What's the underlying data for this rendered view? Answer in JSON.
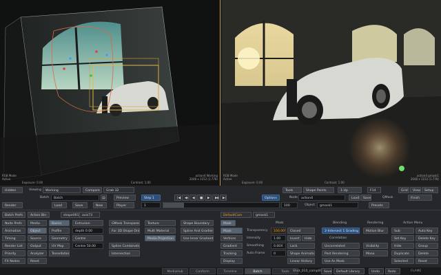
{
  "viewer_left": {
    "mode_line1": "RGB Mode",
    "mode_line2": "Active",
    "exposure": "Exposure: 0.00",
    "contrast": "Contrast: 1.00",
    "name": "action4 Working",
    "res": "2048 x 1152 (1.778)"
  },
  "viewer_right": {
    "mode_line1": "RGB Mode",
    "mode_line2": "Active",
    "exposure": "Exposure: 0.00",
    "contrast": "Contrast: 1.00",
    "name": "action4 gmask1",
    "res": "2048 x 1152 (1.778)"
  },
  "row1": {
    "hidden": "Hidden",
    "viewing_label": "Viewing",
    "viewing_value": "Working",
    "compare": "Compare",
    "grab": "Grab 32",
    "tools": "Tools",
    "shape_points": "Shape Points",
    "view_mode": "1-Up",
    "zoom": "F14",
    "grid": "Grid",
    "view": "View",
    "setup": "Setup"
  },
  "row2": {
    "batch_label": "Batch",
    "batch_value": "Batch",
    "preview": "Preview",
    "step": "Step 1",
    "options": "Options",
    "node_label": "Node",
    "node_value": "action4",
    "load": "Load",
    "save": "Save",
    "qmask": "QMask",
    "finish": "Finish"
  },
  "row3": {
    "render": "Render",
    "load": "Load",
    "save": "Save",
    "new": "New",
    "player": "Player",
    "frame": "1",
    "end_frame": "100",
    "object_label": "Object",
    "object_value": "gmask1",
    "presets": "Presets"
  },
  "row4": {
    "batch_prefs": "Batch Prefs",
    "action_bin": "Action Bin",
    "shape": "shape001",
    "axis": "axis73",
    "defaultcam": "DefaultCam",
    "gmask": "gmask1"
  },
  "left_grid": [
    [
      "Node Prefs",
      "Media",
      "Basics",
      "Extrusion",
      "GMask Transparency",
      "Texture",
      "Shape Boundary"
    ],
    [
      "Animation",
      "Object",
      "Profile",
      "depth 0.00",
      "For 3D Shape Only",
      "Multi Material",
      "Spline And Gradient"
    ],
    [
      "Timing",
      "Source",
      "Geometry",
      "Centre",
      "",
      "Media Projection",
      "Use Inner Gradients"
    ],
    [
      "Render List",
      "Output",
      "UV Map",
      "Centre 50.00",
      "Spline Combination",
      "",
      ""
    ],
    [
      "Priority",
      "Analyzer",
      "Tessellation",
      "",
      "Intersection",
      "",
      ""
    ],
    [
      "FX Nodes",
      "Reset",
      "",
      "",
      "",
      "",
      ""
    ]
  ],
  "mask": {
    "mode": "Mask",
    "header": "Mask",
    "transparency_label": "Transparency",
    "transparency_value": "100.00%",
    "closed": "Closed",
    "intensity_label": "Intensity",
    "intensity_value": "1.00",
    "invert": "Invert",
    "hide": "Hide",
    "smoothing_label": "Smoothing",
    "smoothing_value": "0.00X",
    "lock": "Lock",
    "autoframe": "Auto Frame",
    "autoframe_value": "0",
    "shape_animation": "Shape Animation",
    "linear_history": "Linear History",
    "side_buttons": [
      "Mask",
      "Vertices",
      "Gradient",
      "Tracking",
      "Display"
    ]
  },
  "blending": {
    "header": "Blending",
    "mode": "2-Intersect 1 Grading",
    "correlation": "Correlation",
    "uncorrelated": "Uncorrelated",
    "post_rendering": "Post Rendering",
    "use_as_mask": "Use As Mask"
  },
  "rendering": {
    "header": "Rendering",
    "motion_blur": "Motion Blur",
    "visibility": "Visibility",
    "mono": "Mono"
  },
  "action_menu": {
    "header": "Action Menu",
    "buttons": [
      [
        "Sub",
        "Auto Key"
      ],
      [
        "Set Key",
        "Delete Key"
      ],
      [
        "Hide",
        "Group"
      ],
      [
        "Duplicate",
        "Delete"
      ],
      [
        "Selected",
        "Reset"
      ]
    ]
  },
  "tabs": [
    "MediaHub",
    "Conform",
    "Timeline",
    "Batch",
    "Tools"
  ],
  "status": {
    "shot": "Shot_010_comp001",
    "save": "Save",
    "library": "Default Library",
    "undo": "Undo",
    "redo": "Redo",
    "brand": "FLAME"
  }
}
